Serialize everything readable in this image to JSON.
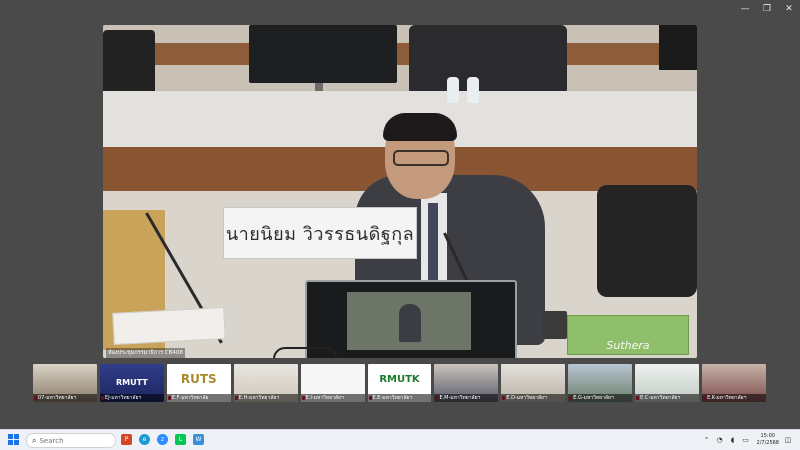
{
  "window": {
    "controls": {
      "minimize": "—",
      "restore": "❐",
      "close": "✕"
    }
  },
  "main_video": {
    "nameplate": "นายนิยม  วิวรรธนดิฐกุล",
    "caption": "ห้องประชุมกรรมาธิการ CB408",
    "green_box_text": "Suthera"
  },
  "thumbnails": [
    {
      "label": "07-มหาวิทยาลัยฯ",
      "brand": ""
    },
    {
      "label": "EJ-มหาวิทยาลัยฯ",
      "brand": "RMUTT"
    },
    {
      "label": "E.F-มหาวิทยาลัย",
      "brand": "RUTS"
    },
    {
      "label": "E.H-มหาวิทยาลัยฯ",
      "brand": ""
    },
    {
      "label": "E.I-มหาวิทยาลัยฯ",
      "brand": ""
    },
    {
      "label": "E.E-มหาวิทยาลัยฯ",
      "brand": "RMUTK"
    },
    {
      "label": "E.M-มหาวิทยาลัยฯ",
      "brand": ""
    },
    {
      "label": "E.D-มหาวิทยาลัยฯ",
      "brand": ""
    },
    {
      "label": "E.G-มหาวิทยาลัยฯ",
      "brand": ""
    },
    {
      "label": "E.C-มหาวิทยาลัยฯ",
      "brand": ""
    },
    {
      "label": "E.K-มหาวิทยาลัยฯ",
      "brand": ""
    }
  ],
  "taskbar": {
    "search_placeholder": "Search",
    "clock_time": "15:00",
    "clock_date": "2/7/2568"
  },
  "colors": {
    "accent": "#1a73e8",
    "taskbar_bg": "#eef1f5",
    "window_bg": "#4a4a4a"
  },
  "icons": [
    "minimize-icon",
    "restore-icon",
    "close-icon",
    "windows-start-icon",
    "search-icon",
    "powerpoint-icon",
    "edge-icon",
    "zoom-icon",
    "line-icon",
    "word-icon",
    "chevron-up-icon",
    "wifi-icon",
    "volume-icon",
    "battery-icon",
    "notification-icon"
  ]
}
